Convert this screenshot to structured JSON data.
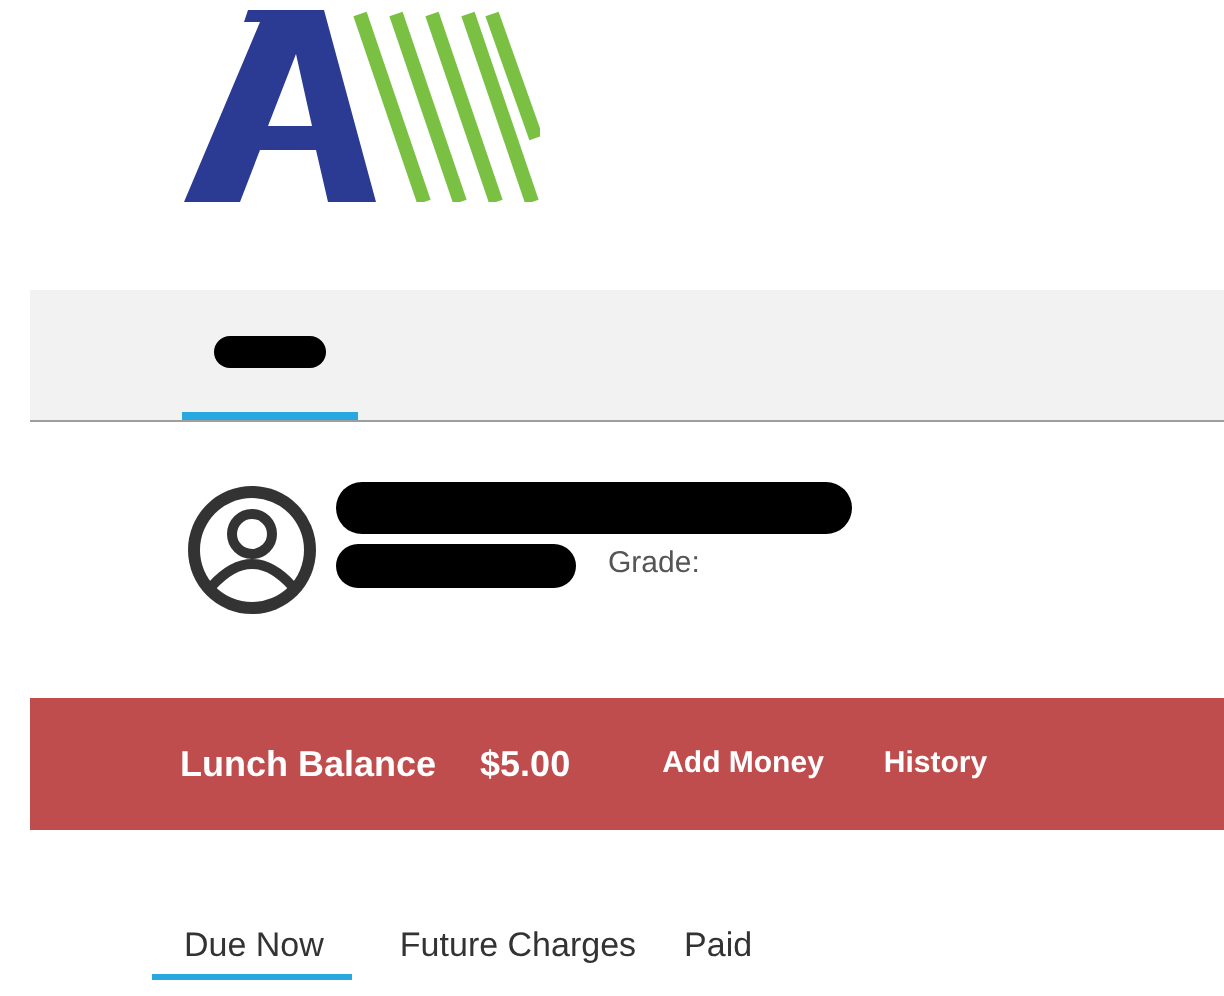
{
  "top_tabs": [
    {
      "redacted": true,
      "selected": true
    }
  ],
  "student": {
    "name_redacted": true,
    "id_redacted": true,
    "grade_label": "Grade:"
  },
  "balance_bar": {
    "label": "Lunch Balance",
    "amount": "$5.00",
    "links": [
      "Add Money",
      "History"
    ]
  },
  "tabs": [
    {
      "label": "Due Now",
      "selected": true
    },
    {
      "label": "Future Charges",
      "selected": false
    },
    {
      "label": "Paid",
      "selected": false
    }
  ]
}
